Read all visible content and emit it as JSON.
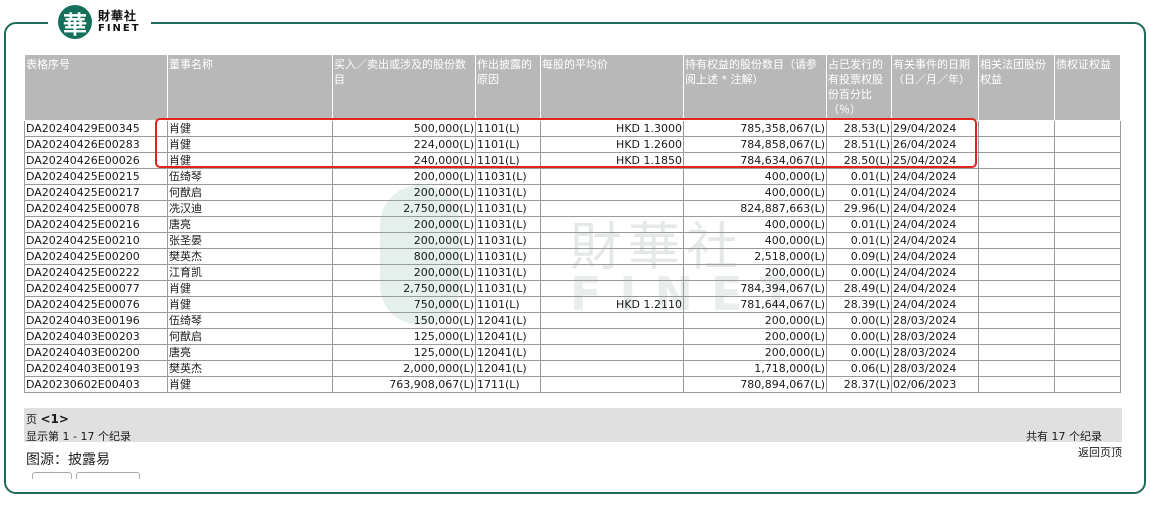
{
  "logo": {
    "mark": "華",
    "cn": "財華社",
    "en": "FINET"
  },
  "watermark": {
    "cn": "財華社",
    "en": "FINET"
  },
  "table": {
    "headers": [
      "表格序号",
      "董事名称",
      "买入／卖出或涉及的股份数目",
      "作出披露的原因",
      "每股的平均价",
      "持有权益的股份数目（请参阅上述 * 注解）",
      "占已发行的有投票权股份百分比（％）",
      "有关事件的日期（日／月／年）",
      "相关法团股份权益",
      "债权证权益"
    ],
    "rows": [
      [
        "DA20240429E00345",
        "肖健",
        "500,000(L)",
        "1101(L)",
        "HKD 1.3000",
        "785,358,067(L)",
        "28.53(L)",
        "29/04/2024",
        "",
        ""
      ],
      [
        "DA20240426E00283",
        "肖健",
        "224,000(L)",
        "1101(L)",
        "HKD 1.2600",
        "784,858,067(L)",
        "28.51(L)",
        "26/04/2024",
        "",
        ""
      ],
      [
        "DA20240426E00026",
        "肖健",
        "240,000(L)",
        "1101(L)",
        "HKD 1.1850",
        "784,634,067(L)",
        "28.50(L)",
        "25/04/2024",
        "",
        ""
      ],
      [
        "DA20240425E00215",
        "伍绮琴",
        "200,000(L)",
        "11031(L)",
        "",
        "400,000(L)",
        "0.01(L)",
        "24/04/2024",
        "",
        ""
      ],
      [
        "DA20240425E00217",
        "何猷启",
        "200,000(L)",
        "11031(L)",
        "",
        "400,000(L)",
        "0.01(L)",
        "24/04/2024",
        "",
        ""
      ],
      [
        "DA20240425E00078",
        "冼汉迪",
        "2,750,000(L)",
        "11031(L)",
        "",
        "824,887,663(L)",
        "29.96(L)",
        "24/04/2024",
        "",
        ""
      ],
      [
        "DA20240425E00216",
        "唐亮",
        "200,000(L)",
        "11031(L)",
        "",
        "400,000(L)",
        "0.01(L)",
        "24/04/2024",
        "",
        ""
      ],
      [
        "DA20240425E00210",
        "张圣晏",
        "200,000(L)",
        "11031(L)",
        "",
        "400,000(L)",
        "0.01(L)",
        "24/04/2024",
        "",
        ""
      ],
      [
        "DA20240425E00200",
        "樊英杰",
        "800,000(L)",
        "11031(L)",
        "",
        "2,518,000(L)",
        "0.09(L)",
        "24/04/2024",
        "",
        ""
      ],
      [
        "DA20240425E00222",
        "江育凯",
        "200,000(L)",
        "11031(L)",
        "",
        "200,000(L)",
        "0.00(L)",
        "24/04/2024",
        "",
        ""
      ],
      [
        "DA20240425E00077",
        "肖健",
        "2,750,000(L)",
        "11031(L)",
        "",
        "784,394,067(L)",
        "28.49(L)",
        "24/04/2024",
        "",
        ""
      ],
      [
        "DA20240425E00076",
        "肖健",
        "750,000(L)",
        "1101(L)",
        "HKD 1.2110",
        "781,644,067(L)",
        "28.39(L)",
        "24/04/2024",
        "",
        ""
      ],
      [
        "DA20240403E00196",
        "伍绮琴",
        "150,000(L)",
        "12041(L)",
        "",
        "200,000(L)",
        "0.00(L)",
        "28/03/2024",
        "",
        ""
      ],
      [
        "DA20240403E00203",
        "何猷启",
        "125,000(L)",
        "12041(L)",
        "",
        "200,000(L)",
        "0.00(L)",
        "28/03/2024",
        "",
        ""
      ],
      [
        "DA20240403E00200",
        "唐亮",
        "125,000(L)",
        "12041(L)",
        "",
        "200,000(L)",
        "0.00(L)",
        "28/03/2024",
        "",
        ""
      ],
      [
        "DA20240403E00193",
        "樊英杰",
        "2,000,000(L)",
        "12041(L)",
        "",
        "1,718,000(L)",
        "0.06(L)",
        "28/03/2024",
        "",
        ""
      ],
      [
        "DA20230602E00403",
        "肖健",
        "763,908,067(L)",
        "1711(L)",
        "",
        "780,894,067(L)",
        "28.37(L)",
        "02/06/2023",
        "",
        ""
      ]
    ]
  },
  "footer": {
    "page_label": "页",
    "page_current": "<1>",
    "showing": "显示第 1 - 17 个纪录",
    "total": "共有 17 个纪录",
    "back": "返回页顶"
  },
  "source": "图源：披露易",
  "colors": {
    "brand": "#1f6b5a",
    "highlight": "#e0241e",
    "header_bg": "#b8b8b8"
  }
}
